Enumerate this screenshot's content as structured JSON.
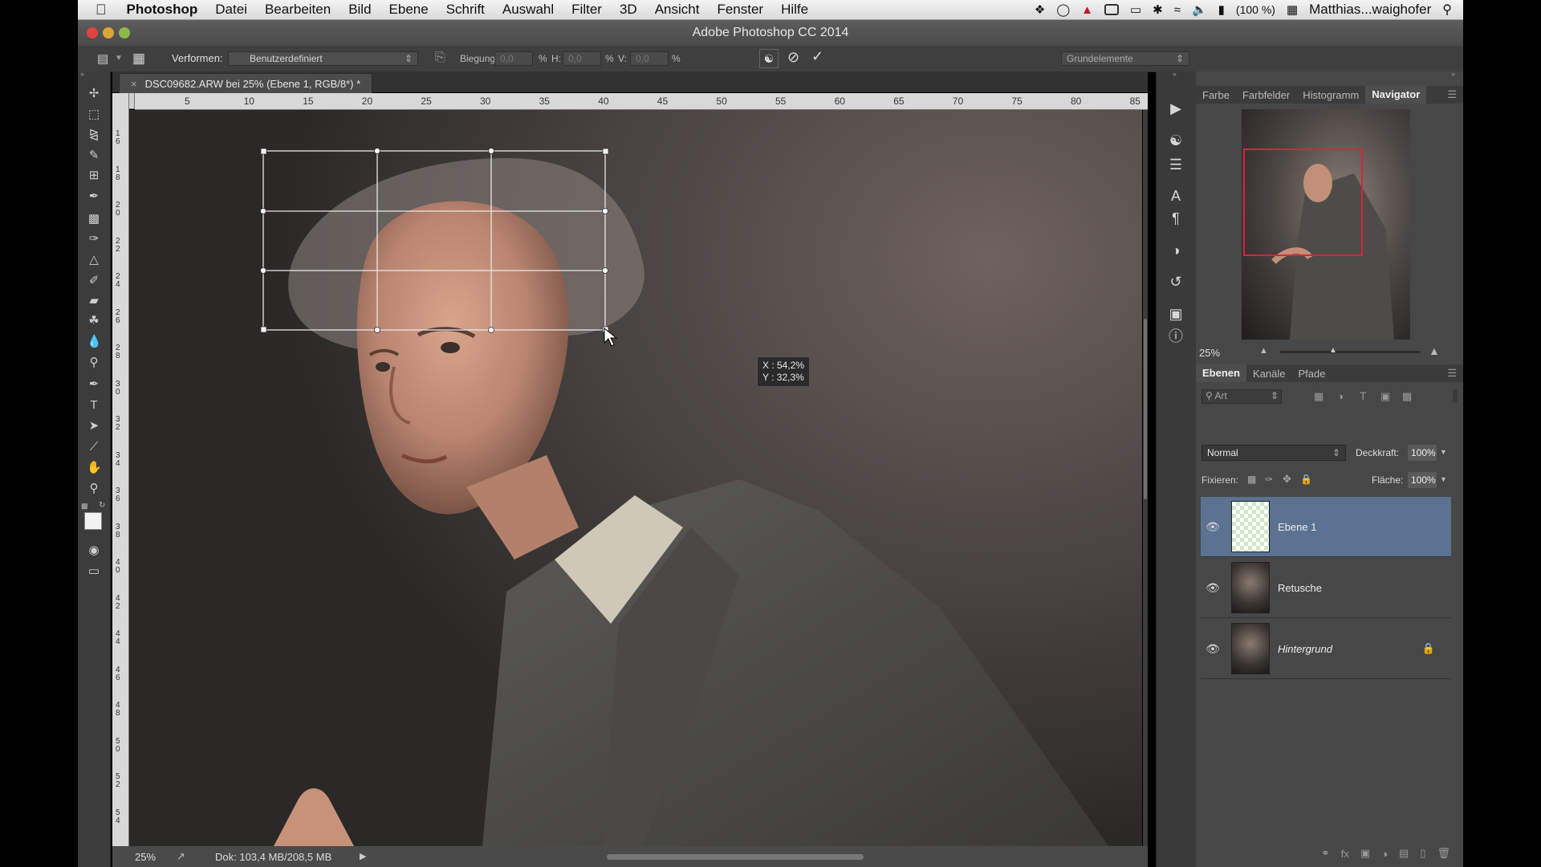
{
  "menubar": {
    "app_name": "Photoshop",
    "items": [
      "Datei",
      "Bearbeiten",
      "Bild",
      "Ebene",
      "Schrift",
      "Auswahl",
      "Filter",
      "3D",
      "Ansicht",
      "Fenster",
      "Hilfe"
    ],
    "battery": "(100 %)",
    "user": "Matthias...waighofer"
  },
  "window": {
    "title": "Adobe Photoshop CC 2014"
  },
  "optbar": {
    "verformen_label": "Verformen:",
    "preset_value": "Benutzerdefiniert",
    "biegung_label": "Biegung:",
    "biegung_value": "0,0",
    "h_label": "H:",
    "h_value": "0,0",
    "v_label": "V:",
    "v_value": "0,0",
    "percent": "%",
    "workspace": "Grundelemente"
  },
  "document": {
    "tab_title": "DSC09682.ARW bei 25% (Ebene 1, RGB/8*) *",
    "zoom": "25%",
    "doc_size": "Dok: 103,4 MB/208,5 MB"
  },
  "ruler": {
    "h_ticks": [
      "5",
      "10",
      "15",
      "20",
      "25",
      "30",
      "35",
      "40",
      "45",
      "50",
      "55",
      "60",
      "65",
      "70",
      "75",
      "80",
      "85"
    ],
    "v_ticks": [
      "16",
      "18",
      "20",
      "22",
      "24",
      "26",
      "28",
      "30",
      "32",
      "34",
      "36",
      "38",
      "40",
      "42",
      "44",
      "46",
      "48",
      "50",
      "52",
      "54"
    ]
  },
  "warp_tooltip": {
    "x": "X : 54,2%",
    "y": "Y : 32,3%"
  },
  "panels": {
    "top_tabs": [
      "Farbe",
      "Farbfelder",
      "Histogramm",
      "Navigator"
    ],
    "navigator_zoom": "25%",
    "layer_tabs": [
      "Ebenen",
      "Kanäle",
      "Pfade"
    ],
    "filter_label": "Art",
    "blend_mode": "Normal",
    "opacity_label": "Deckkraft:",
    "opacity_value": "100%",
    "lock_label": "Fixieren:",
    "fill_label": "Fläche:",
    "fill_value": "100%",
    "layers": [
      {
        "name": "Ebene 1"
      },
      {
        "name": "Retusche"
      },
      {
        "name": "Hintergrund"
      }
    ]
  },
  "colors": {
    "selection": "#5b7291",
    "navigator_frame": "#e0203a"
  }
}
